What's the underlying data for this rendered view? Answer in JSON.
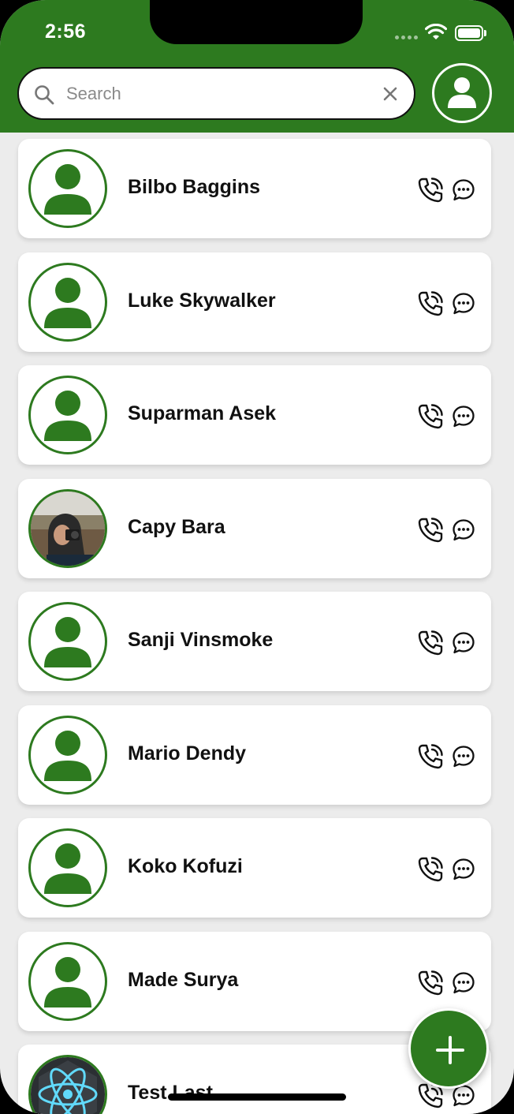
{
  "status_bar": {
    "time": "2:56"
  },
  "search": {
    "placeholder": "Search",
    "value": ""
  },
  "colors": {
    "brand": "#2d7a1f",
    "background": "#ececec",
    "card": "#ffffff"
  },
  "contacts": [
    {
      "name": "Bilbo Baggins",
      "avatar": "person-icon"
    },
    {
      "name": "Luke Skywalker",
      "avatar": "person-icon"
    },
    {
      "name": "Suparman Asek",
      "avatar": "person-icon"
    },
    {
      "name": "Capy Bara",
      "avatar": "photo"
    },
    {
      "name": "Sanji Vinsmoke",
      "avatar": "person-icon"
    },
    {
      "name": "Mario Dendy",
      "avatar": "person-icon"
    },
    {
      "name": "Koko Kofuzi",
      "avatar": "person-icon"
    },
    {
      "name": "Made Surya",
      "avatar": "person-icon"
    },
    {
      "name": "Test Last",
      "avatar": "react-logo"
    }
  ],
  "icons": {
    "search": "search-icon",
    "clear": "close-icon",
    "profile": "user-icon",
    "call": "phone-icon",
    "message": "chat-bubble-icon",
    "add": "plus-icon"
  }
}
